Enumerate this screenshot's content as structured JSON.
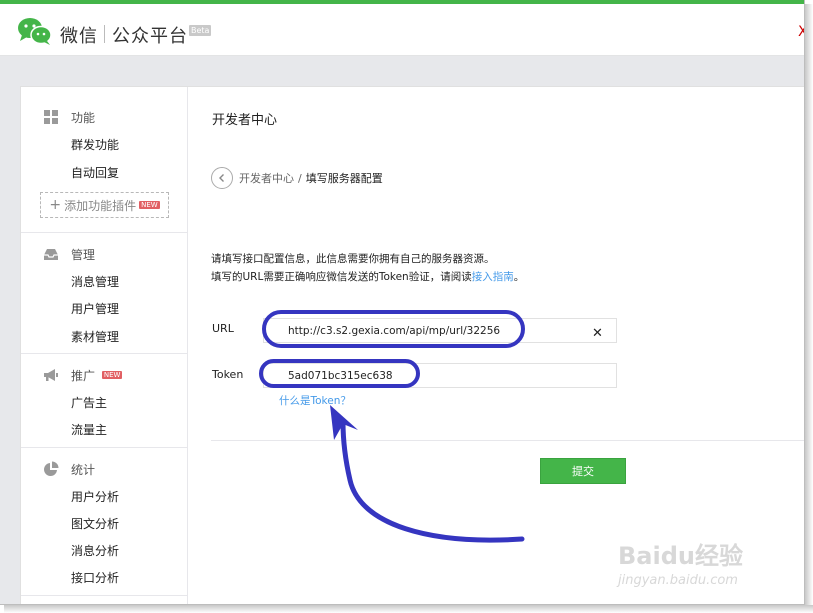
{
  "header": {
    "brand": "微信",
    "platform": "公众平台",
    "beta_badge": "Beta",
    "close_glyph": "X"
  },
  "sidebar": {
    "groups": [
      {
        "icon": "grid-icon",
        "label": "功能",
        "items": [
          "群发功能",
          "自动回复"
        ],
        "add_plugin": "添加功能插件",
        "plugin_badge": "NEW"
      },
      {
        "icon": "inbox-icon",
        "label": "管理",
        "items": [
          "消息管理",
          "用户管理",
          "素材管理"
        ]
      },
      {
        "icon": "megaphone-icon",
        "label": "推广",
        "badge": "NEW",
        "items": [
          "广告主",
          "流量主"
        ]
      },
      {
        "icon": "pie-chart-icon",
        "label": "统计",
        "items": [
          "用户分析",
          "图文分析",
          "消息分析",
          "接口分析"
        ]
      }
    ]
  },
  "main": {
    "title": "开发者中心",
    "breadcrumb": {
      "parent": "开发者中心",
      "separator": "/",
      "current": "填写服务器配置"
    },
    "intro_line1": "请填写接口配置信息，此信息需要你拥有自己的服务器资源。",
    "intro_line2_prefix": "填写的URL需要正确响应微信发送的Token验证，请阅读",
    "intro_link": "接入指南",
    "intro_line2_suffix": "。",
    "url_label": "URL",
    "url_value": "http://c3.s2.gexia.com/api/mp/url/32256",
    "clear_glyph": "✕",
    "token_label": "Token",
    "token_value": "5ad071bc315ec638",
    "token_help": "什么是Token？",
    "submit_label": "提交"
  },
  "annotation": {
    "color": "#3535c0"
  },
  "watermark": {
    "logo": "Baidu经验",
    "url": "jingyan.baidu.com"
  }
}
